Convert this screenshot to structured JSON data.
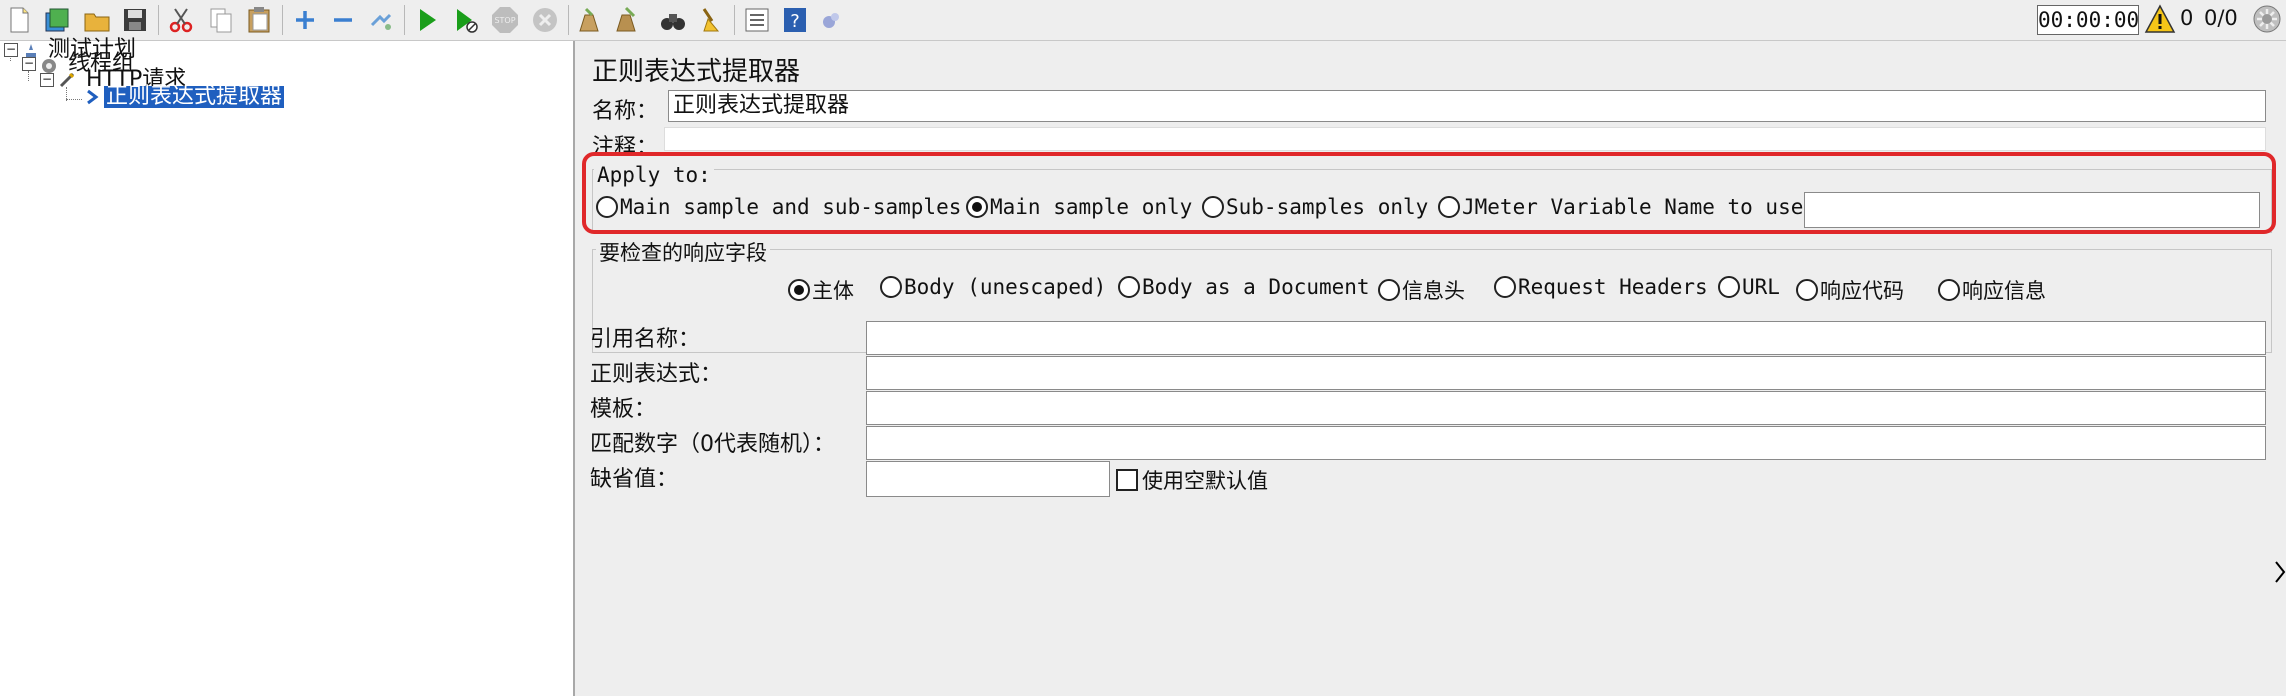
{
  "toolbar": {
    "buttons": [
      {
        "name": "new-icon"
      },
      {
        "name": "templates-icon"
      },
      {
        "name": "open-icon"
      },
      {
        "name": "save-icon"
      },
      {
        "name": "cut-icon"
      },
      {
        "name": "copy-icon"
      },
      {
        "name": "paste-icon"
      },
      {
        "name": "expand-icon"
      },
      {
        "name": "collapse-icon"
      },
      {
        "name": "toggle-icon"
      },
      {
        "name": "start-icon"
      },
      {
        "name": "start-no-pauses-icon"
      },
      {
        "name": "stop-icon"
      },
      {
        "name": "shutdown-icon"
      },
      {
        "name": "clear-icon"
      },
      {
        "name": "clear-all-icon"
      },
      {
        "name": "search-icon"
      },
      {
        "name": "reset-search-icon"
      },
      {
        "name": "function-helper-icon"
      },
      {
        "name": "help-icon"
      },
      {
        "name": "remote-icon"
      }
    ],
    "stop_label": "STOP",
    "timer": "00:00:00",
    "warning_count": "0",
    "thread_count": "0/0"
  },
  "tree": {
    "items": [
      {
        "label": "测试计划"
      },
      {
        "label": "线程组"
      },
      {
        "label": "HTTP请求"
      },
      {
        "label": "正则表达式提取器"
      }
    ]
  },
  "panel": {
    "title": "正则表达式提取器",
    "name_label": "名称：",
    "name_value": "正则表达式提取器",
    "comment_label": "注释：",
    "apply_to": {
      "title": "Apply to:",
      "options": [
        {
          "label": "Main sample and sub-samples",
          "checked": false
        },
        {
          "label": "Main sample only",
          "checked": true
        },
        {
          "label": "Sub-samples only",
          "checked": false
        },
        {
          "label": "JMeter Variable Name to use",
          "checked": false
        }
      ],
      "variable_value": ""
    },
    "response_field": {
      "title": "要检查的响应字段",
      "options": [
        {
          "label": "主体",
          "checked": true
        },
        {
          "label": "Body (unescaped)",
          "checked": false
        },
        {
          "label": "Body as a Document",
          "checked": false
        },
        {
          "label": "信息头",
          "checked": false
        },
        {
          "label": "Request Headers",
          "checked": false
        },
        {
          "label": "URL",
          "checked": false
        },
        {
          "label": "响应代码",
          "checked": false
        },
        {
          "label": "响应信息",
          "checked": false
        }
      ]
    },
    "fields": {
      "ref_name_label": "引用名称：",
      "regex_label": "正则表达式：",
      "template_label": "模板：",
      "match_no_label": "匹配数字（0代表随机）：",
      "default_label": "缺省值：",
      "ref_name_value": "",
      "regex_value": "",
      "template_value": "",
      "match_no_value": "",
      "default_value": ""
    },
    "use_empty_default_label": "使用空默认值"
  },
  "colors": {
    "highlight": "#e0282a",
    "selection": "#1f5fbf",
    "start_green": "#1a9e1a"
  }
}
